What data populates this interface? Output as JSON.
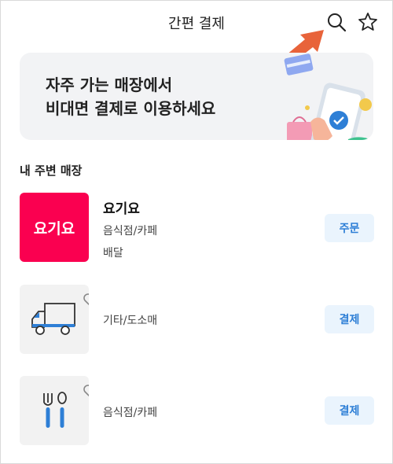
{
  "header": {
    "title": "간편 결제",
    "search_icon": "search-icon",
    "favorite_icon": "star-outline-icon"
  },
  "banner": {
    "line1": "자주 가는 매장에서",
    "line2": "비대면 결제로 이용하세요"
  },
  "section_title": "내 주변 매장",
  "stores": [
    {
      "logo_text": "요기요",
      "name": "요기요",
      "category": "음식점/카페",
      "extra": "배달",
      "action": "주문",
      "thumb_icon": "yogiyo-logo",
      "brand_color": "#fa0050"
    },
    {
      "name": "",
      "category": "기타/도소매",
      "action": "결제",
      "thumb_icon": "delivery-truck-icon"
    },
    {
      "name": "",
      "category": "음식점/카페",
      "action": "결제",
      "thumb_icon": "fork-spoon-icon"
    }
  ],
  "colors": {
    "accent_blue": "#2e7fd6",
    "button_bg": "#eaf4fd",
    "banner_bg": "#f2f3f5",
    "arrow_orange": "#e8633a"
  }
}
